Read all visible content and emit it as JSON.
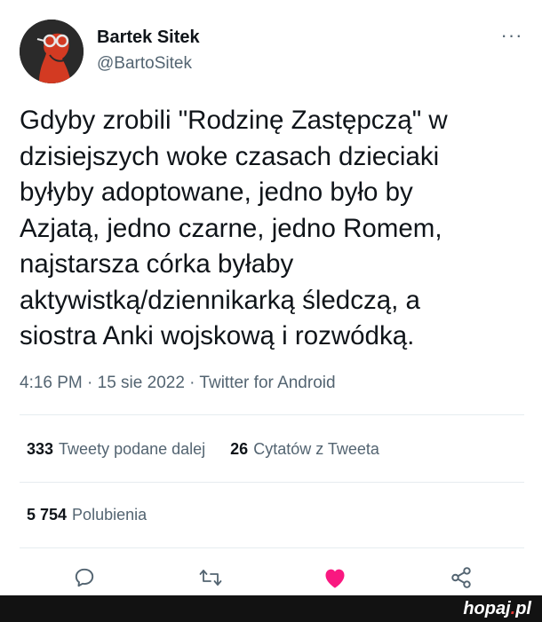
{
  "author": {
    "name": "Bartek Sitek",
    "handle": "@BartoSitek"
  },
  "more_label": "···",
  "tweet": {
    "text": "Gdyby zrobili \"Rodzinę Zastępczą\" w\ndzisiejszych woke czasach dzieciaki\nbyłyby adoptowane, jedno było by\nAzjatą, jedno czarne, jedno Romem,\nnajstarsza córka byłaby\naktywistką/dziennikarką śledczą, a\nsiostra Anki wojskową i rozwódką.",
    "meta": "4:16 PM · 15 sie 2022 · Twitter for Android"
  },
  "stats": {
    "retweets_count": "333",
    "retweets_label": "Tweety podane dalej",
    "quotes_count": "26",
    "quotes_label": "Cytatów z Tweeta",
    "likes_count": "5 754",
    "likes_label": "Polubienia"
  },
  "actions": [
    "reply-icon",
    "retweet-icon",
    "like-icon",
    "share-icon"
  ],
  "colors": {
    "text": "#0f1419",
    "secondary": "#536471",
    "like": "#f91880",
    "divider": "#e6ecf0",
    "bottom_bar": "#121212"
  },
  "watermark": {
    "brand": "hopaj",
    "dot": ".",
    "tld": "pl"
  }
}
